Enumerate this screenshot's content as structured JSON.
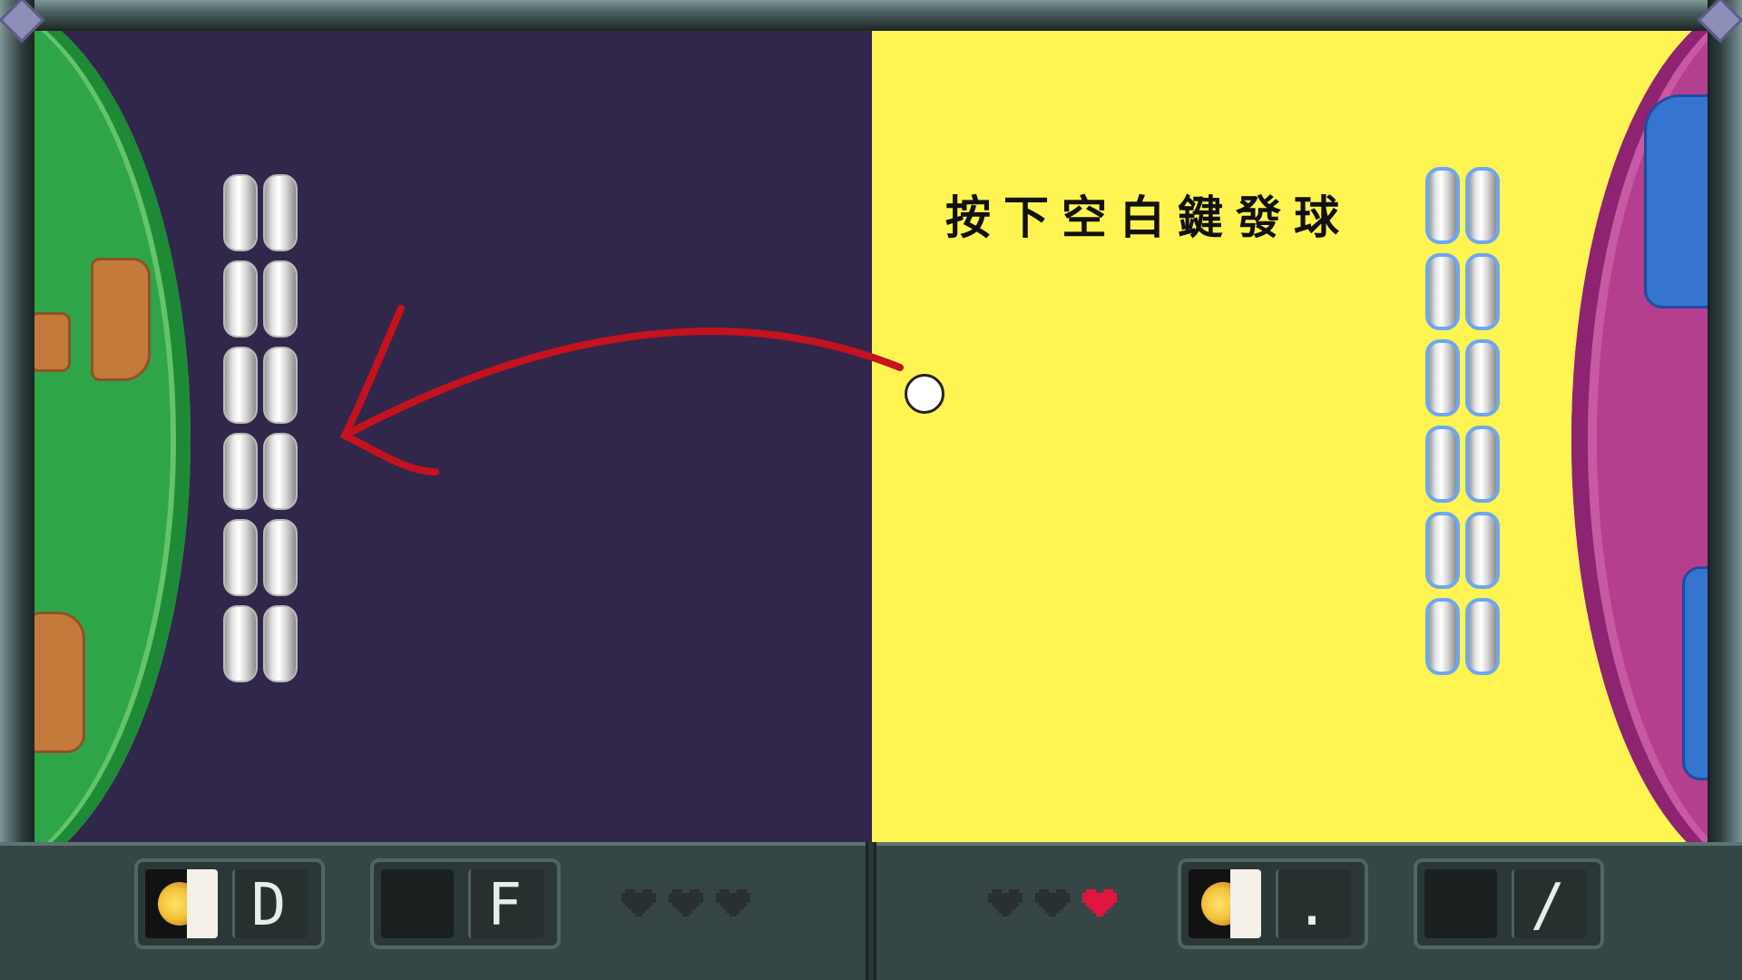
{
  "game": {
    "hint_text": "按下空白鍵發球",
    "player_left": {
      "court_color": "#31274a",
      "planet_color": "#2fa54a",
      "skill_key": "D",
      "second_key": "F",
      "skill_icon": "moon-sun-icon",
      "lives_total": 3,
      "lives_remaining": 0,
      "paddle_segments": 12
    },
    "player_right": {
      "court_color": "#fff451",
      "planet_color": "#b43f8f",
      "skill_key": ".",
      "second_key": "/",
      "skill_icon": "moon-sun-icon",
      "lives_total": 3,
      "lives_remaining": 1,
      "paddle_segments": 12
    },
    "ball": {
      "color": "#ffffff"
    },
    "arrow_color": "#c4121e"
  }
}
